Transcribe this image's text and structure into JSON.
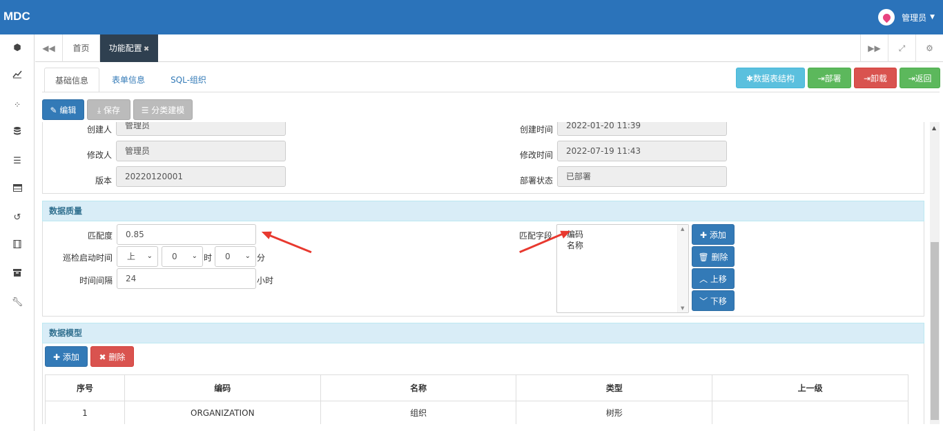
{
  "app": {
    "brand": "MDC",
    "user": "管理员"
  },
  "sidebar": {
    "icons": [
      "cube-icon",
      "chart-line-icon",
      "spinner-icon",
      "database-icon",
      "list-icon",
      "table-icon",
      "history-icon",
      "film-icon",
      "archive-icon",
      "wrench-icon"
    ]
  },
  "tabs": {
    "home": "首页",
    "active": "功能配置",
    "close": "✖"
  },
  "subtabs": [
    "基础信息",
    "表单信息",
    "SQL-组织"
  ],
  "toolbar_right": {
    "structure": "数据表结构",
    "deploy": "部署",
    "undeploy": "卸载",
    "back": "返回"
  },
  "toolbar_left": {
    "edit": "编辑",
    "save": "保存",
    "model": "分类建模"
  },
  "basic": {
    "creator_label": "创建人",
    "creator": "管理员",
    "created_label": "创建时间",
    "created": "2022-01-20 11:39",
    "modifier_label": "修改人",
    "modifier": "管理员",
    "modified_label": "修改时间",
    "modified": "2022-07-19 11:43",
    "version_label": "版本",
    "version": "20220120001",
    "deploy_state_label": "部署状态",
    "deploy_state": "已部署"
  },
  "quality": {
    "title": "数据质量",
    "match_label": "匹配度",
    "match": "0.85",
    "patrol_label": "巡检启动时间",
    "ampm": "上",
    "hour": "0",
    "hour_unit": "时",
    "minute": "0",
    "minute_unit": "分",
    "interval_label": "时间间隔",
    "interval": "24",
    "interval_unit": "小时",
    "fields_label": "匹配字段",
    "fields": [
      "编码",
      "名称"
    ],
    "add": "添加",
    "remove": "删除",
    "up": "上移",
    "down": "下移"
  },
  "model": {
    "title": "数据模型",
    "add": "添加",
    "remove": "删除",
    "columns": [
      "序号",
      "编码",
      "名称",
      "类型",
      "上一级"
    ],
    "rows": [
      [
        "1",
        "ORGANIZATION",
        "组织",
        "树形",
        ""
      ]
    ]
  },
  "colors": {
    "topbar": "#2b73ba",
    "active_tab": "#2f4050",
    "arrow": "#e8392f"
  }
}
